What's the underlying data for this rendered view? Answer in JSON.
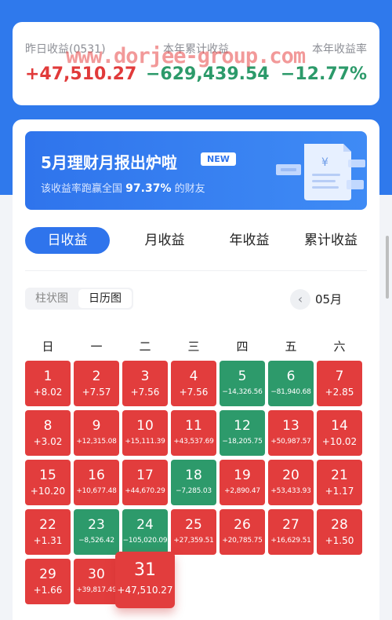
{
  "summary": {
    "yesterday_label": "昨日收益(0531)",
    "yesterday_value": "+47,510.27",
    "year_label": "本年累计收益",
    "year_value": "−629,439.54",
    "rate_label": "本年收益率",
    "rate_value": "−12.77%"
  },
  "watermark": "www.dorjee-group.com",
  "banner": {
    "title": "5月理财月报出炉啦",
    "badge": "NEW",
    "sub_prefix": "该收益率跑赢全国",
    "sub_pct": "97.37%",
    "sub_suffix": "的财友",
    "yen": "¥"
  },
  "tabs": [
    "日收益",
    "月收益",
    "年收益",
    "累计收益"
  ],
  "view_toggle": {
    "bar": "柱状图",
    "calendar": "日历图"
  },
  "month": {
    "prev_icon": "‹",
    "label": "05月"
  },
  "weekdays": [
    "日",
    "一",
    "二",
    "三",
    "四",
    "五",
    "六"
  ],
  "days": [
    {
      "n": "1",
      "v": "+8.02",
      "c": "red"
    },
    {
      "n": "2",
      "v": "+7.57",
      "c": "red"
    },
    {
      "n": "3",
      "v": "+7.56",
      "c": "red"
    },
    {
      "n": "4",
      "v": "+7.56",
      "c": "red"
    },
    {
      "n": "5",
      "v": "−14,326.56",
      "c": "green"
    },
    {
      "n": "6",
      "v": "−81,940.68",
      "c": "green"
    },
    {
      "n": "7",
      "v": "+2.85",
      "c": "red"
    },
    {
      "n": "8",
      "v": "+3.02",
      "c": "red"
    },
    {
      "n": "9",
      "v": "+12,315.08",
      "c": "red"
    },
    {
      "n": "10",
      "v": "+15,111.39",
      "c": "red"
    },
    {
      "n": "11",
      "v": "+43,537.69",
      "c": "red"
    },
    {
      "n": "12",
      "v": "−18,205.75",
      "c": "green"
    },
    {
      "n": "13",
      "v": "+50,987.57",
      "c": "red"
    },
    {
      "n": "14",
      "v": "+10.02",
      "c": "red"
    },
    {
      "n": "15",
      "v": "+10.20",
      "c": "red"
    },
    {
      "n": "16",
      "v": "+10,677.48",
      "c": "red"
    },
    {
      "n": "17",
      "v": "+44,670.29",
      "c": "red"
    },
    {
      "n": "18",
      "v": "−7,285.03",
      "c": "green"
    },
    {
      "n": "19",
      "v": "+2,890.47",
      "c": "red"
    },
    {
      "n": "20",
      "v": "+53,433.93",
      "c": "red"
    },
    {
      "n": "21",
      "v": "+1.17",
      "c": "red"
    },
    {
      "n": "22",
      "v": "+1.31",
      "c": "red"
    },
    {
      "n": "23",
      "v": "−8,526.42",
      "c": "green"
    },
    {
      "n": "24",
      "v": "−105,020.09",
      "c": "green"
    },
    {
      "n": "25",
      "v": "+27,359.51",
      "c": "red"
    },
    {
      "n": "26",
      "v": "+20,785.75",
      "c": "red"
    },
    {
      "n": "27",
      "v": "+16,629.51",
      "c": "red"
    },
    {
      "n": "28",
      "v": "+1.50",
      "c": "red"
    },
    {
      "n": "29",
      "v": "+1.66",
      "c": "red"
    },
    {
      "n": "30",
      "v": "+39,817.49",
      "c": "red"
    },
    {
      "n": "31",
      "v": "+47,510.27",
      "c": "red",
      "selected": true
    }
  ],
  "colors": {
    "accent": "#2f74ec",
    "gain": "#e23d3d",
    "loss": "#2d9a6b"
  }
}
